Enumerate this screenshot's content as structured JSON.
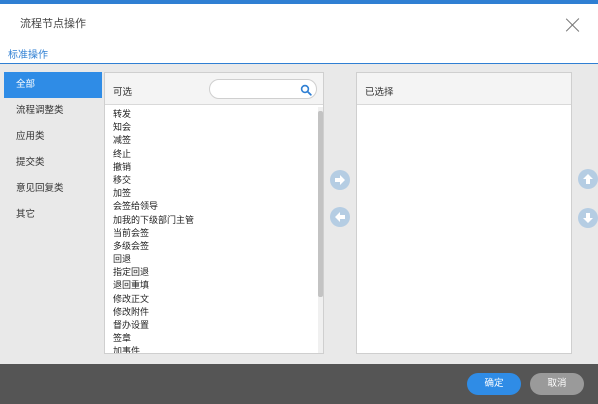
{
  "dialog": {
    "title": "流程节点操作"
  },
  "tabs": [
    {
      "label": "标准操作",
      "active": true
    }
  ],
  "nav": {
    "items": [
      {
        "label": "全部",
        "active": true
      },
      {
        "label": "流程调整类",
        "active": false
      },
      {
        "label": "应用类",
        "active": false
      },
      {
        "label": "提交类",
        "active": false
      },
      {
        "label": "意见回复类",
        "active": false
      },
      {
        "label": "其它",
        "active": false
      }
    ]
  },
  "available": {
    "title": "可选",
    "search_placeholder": "",
    "items": [
      "转发",
      "知会",
      "减签",
      "终止",
      "撤销",
      "移交",
      "加签",
      "会签给领导",
      "加我的下级部门主管",
      "当前会签",
      "多级会签",
      "回退",
      "指定回退",
      "退回重填",
      "修改正文",
      "修改附件",
      "督办设置",
      "签章",
      "加事件"
    ]
  },
  "selected": {
    "title": "已选择",
    "items": []
  },
  "icons": {
    "search": "search-icon",
    "close": "close-icon",
    "move_right": "arrow-right-icon",
    "move_left": "arrow-left-icon",
    "move_up": "arrow-up-icon",
    "move_down": "arrow-down-icon"
  },
  "footer": {
    "ok_label": "确定",
    "cancel_label": "取消"
  },
  "colors": {
    "accent": "#2f8ce6",
    "round_button": "#b5cde3",
    "footer_bg": "#555555",
    "cancel_bg": "#9a9a9a"
  }
}
